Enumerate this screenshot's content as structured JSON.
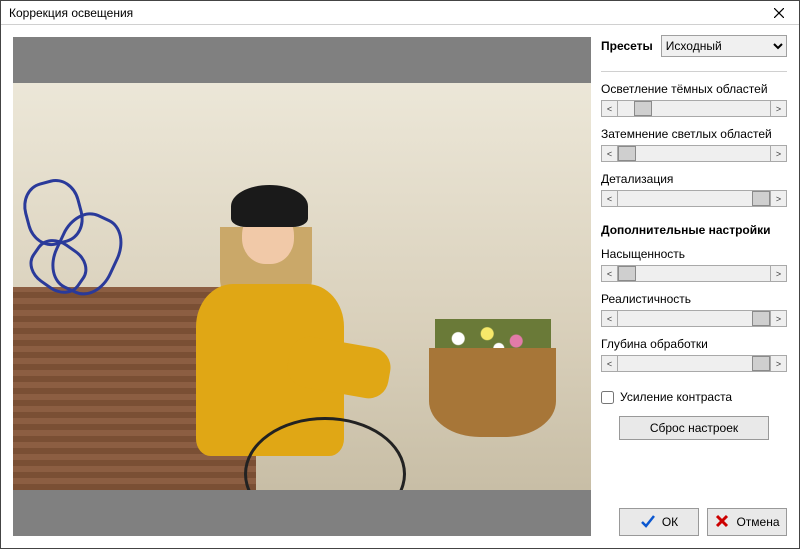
{
  "window": {
    "title": "Коррекция освещения"
  },
  "presets": {
    "label": "Пресеты",
    "selected": "Исходный"
  },
  "sliders": {
    "lighten_dark": {
      "label": "Осветление тёмных областей",
      "position": 12
    },
    "darken_light": {
      "label": "Затемнение светлых областей",
      "position": 0
    },
    "detail": {
      "label": "Детализация",
      "position": 100
    }
  },
  "advanced": {
    "heading": "Дополнительные настройки",
    "saturation": {
      "label": "Насыщенность",
      "position": 0
    },
    "realism": {
      "label": "Реалистичность",
      "position": 100
    },
    "depth": {
      "label": "Глубина обработки",
      "position": 100
    }
  },
  "contrast": {
    "label": "Усиление контраста",
    "checked": false
  },
  "buttons": {
    "reset": "Сброс настроек",
    "ok": "ОК",
    "cancel": "Отмена"
  }
}
